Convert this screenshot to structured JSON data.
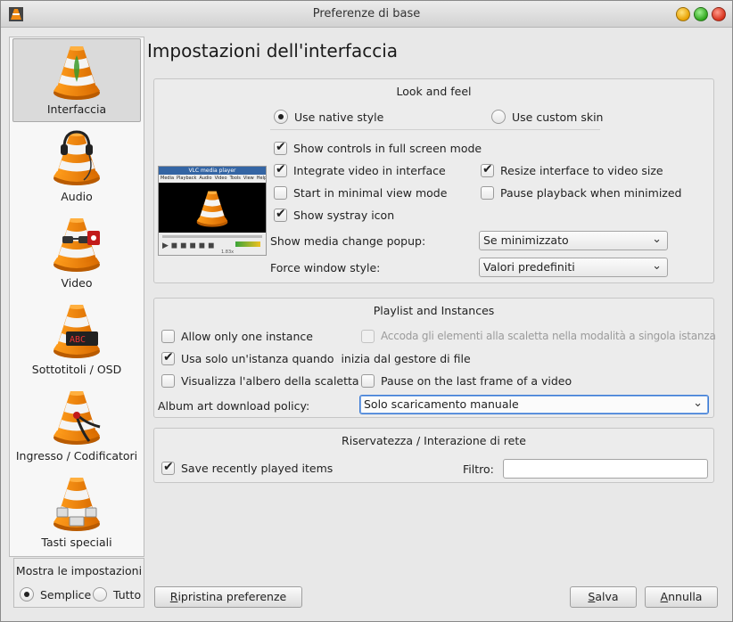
{
  "window": {
    "title": "Preferenze di base"
  },
  "sidebar": {
    "items": [
      {
        "label": "Interfaccia",
        "icon": "vlc-cone-interface-icon",
        "selected": true
      },
      {
        "label": "Audio",
        "icon": "vlc-cone-headphones-icon"
      },
      {
        "label": "Video",
        "icon": "vlc-cone-glasses-icon"
      },
      {
        "label": "Sottotitoli / OSD",
        "icon": "vlc-cone-subtitles-icon"
      },
      {
        "label": "Ingresso / Codificatori",
        "icon": "vlc-cone-cable-icon"
      },
      {
        "label": "Tasti speciali",
        "icon": "vlc-cone-keyboard-icon"
      }
    ]
  },
  "show_settings": {
    "title": "Mostra le impostazioni",
    "simple": "Semplice",
    "all": "Tutto",
    "selected": "simple"
  },
  "page_title": "Impostazioni dell'interfaccia",
  "look_and_feel": {
    "title": "Look and feel",
    "native_style": "Use native style",
    "custom_skin": "Use custom skin",
    "fullscreen_controls": "Show controls in full screen mode",
    "integrate_video": "Integrate video in interface",
    "resize_interface": "Resize interface to video size",
    "minimal_view": "Start in minimal view mode",
    "pause_minimized": "Pause playback when minimized",
    "systray": "Show systray icon",
    "media_popup_label": "Show media change popup:",
    "media_popup_value": "Se minimizzato",
    "window_style_label": "Force window style:",
    "window_style_value": "Valori predefiniti",
    "preview_title": "VLC media player",
    "preview_menu": [
      "Media",
      "Playback",
      "Audio",
      "Video",
      "Tools",
      "View",
      "Help"
    ],
    "preview_time": "1.83x"
  },
  "playlist": {
    "title": "Playlist and Instances",
    "one_instance": "Allow only one instance",
    "enqueue": "Accoda gli elementi alla scaletta nella modalità a singola istanza",
    "single_instance_file_manager": "Usa solo un'istanza quando  inizia dal gestore di file",
    "playlist_tree": "Visualizza l'albero della scaletta",
    "pause_last_frame": "Pause on the last frame of a video",
    "album_art_label": "Album art download policy:",
    "album_art_value": "Solo scaricamento manuale"
  },
  "privacy": {
    "title": "Riservatezza / Interazione di rete",
    "save_recent": "Save recently played items",
    "filter_label": "Filtro:",
    "filter_value": ""
  },
  "buttons": {
    "reset_prefix": "R",
    "reset_rest": "ipristina preferenze",
    "save_prefix": "S",
    "save_rest": "alva",
    "cancel_prefix": "A",
    "cancel_rest": "nnulla"
  },
  "colors": {
    "cone_orange": "#f08a12",
    "focus_blue": "#3b7bd5"
  }
}
